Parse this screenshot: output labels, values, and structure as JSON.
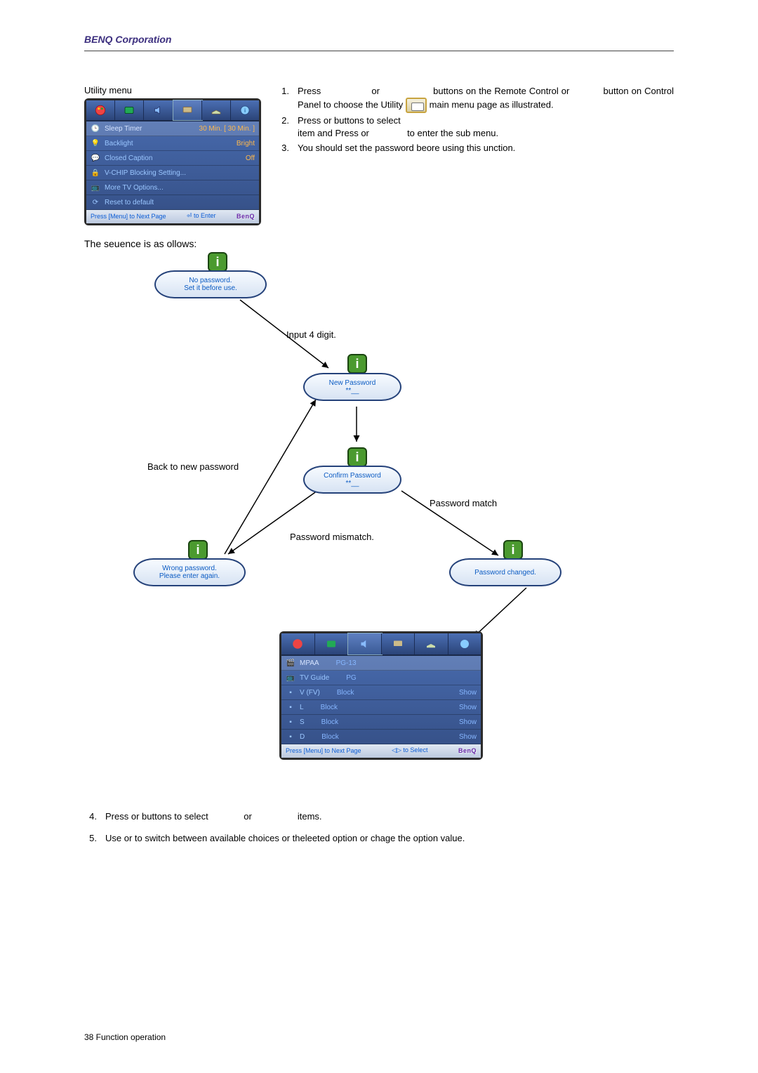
{
  "brand": "BENQ Corporation",
  "section_title": "Utility menu",
  "sequence_line": "The seuence is as ollows:",
  "instructions": {
    "i1_a": "Press",
    "i1_b": "or",
    "i1_c": "buttons on the Remote Control or",
    "i1_d": "button on Control Panel to choose the Utility",
    "i1_e": "main menu page as illustrated.",
    "i2_a": "Press or buttons to select",
    "i2_b": "item and Press or",
    "i2_c": "to enter the sub menu.",
    "i3": "You should set the password beore using this unction."
  },
  "osd": {
    "rows": [
      {
        "label": "Sleep Timer",
        "value": "30   Min.   [   30   Min. ]"
      },
      {
        "label": "Backlight",
        "value": "Bright"
      },
      {
        "label": "Closed Caption",
        "value": "Off"
      },
      {
        "label": "V-CHIP Blocking Setting...",
        "value": ""
      },
      {
        "label": "More TV Options...",
        "value": ""
      },
      {
        "label": "Reset to default",
        "value": ""
      }
    ],
    "footer_left": "Press [Menu] to Next Page",
    "footer_mid": "to Enter",
    "logo": "BenQ"
  },
  "flow": {
    "bubble_no_password_l1": "No password.",
    "bubble_no_password_l2": "Set it before use.",
    "label_input4": "Input 4 digit.",
    "bubble_new_password_l1": "New Password",
    "bubble_new_password_l2": "**__",
    "label_back": "Back to new password",
    "bubble_confirm_l1": "Confirm Password",
    "bubble_confirm_l2": "**__",
    "label_match": "Password match",
    "label_mismatch": "Password mismatch.",
    "bubble_wrong_l1": "Wrong password.",
    "bubble_wrong_l2": "Please enter again.",
    "bubble_changed": "Password changed."
  },
  "osd2": {
    "rows": [
      {
        "label": "MPAA",
        "v1": "PG-13",
        "v2": ""
      },
      {
        "label": "TV Guide",
        "v1": "PG",
        "v2": ""
      },
      {
        "label": "V (FV)",
        "v1": "Block",
        "v2": "Show"
      },
      {
        "label": "L",
        "v1": "Block",
        "v2": "Show"
      },
      {
        "label": "S",
        "v1": "Block",
        "v2": "Show"
      },
      {
        "label": "D",
        "v1": "Block",
        "v2": "Show"
      }
    ],
    "footer_left": "Press [Menu] to Next Page",
    "footer_mid": "to Select",
    "logo": "BenQ"
  },
  "bottom": {
    "i4_a": "Press  or  buttons to select",
    "i4_b": "or",
    "i4_c": "items.",
    "i5": "Use  or  to switch between available choices or theleeted option or chage the option value."
  },
  "footer_text": "38  Function operation"
}
